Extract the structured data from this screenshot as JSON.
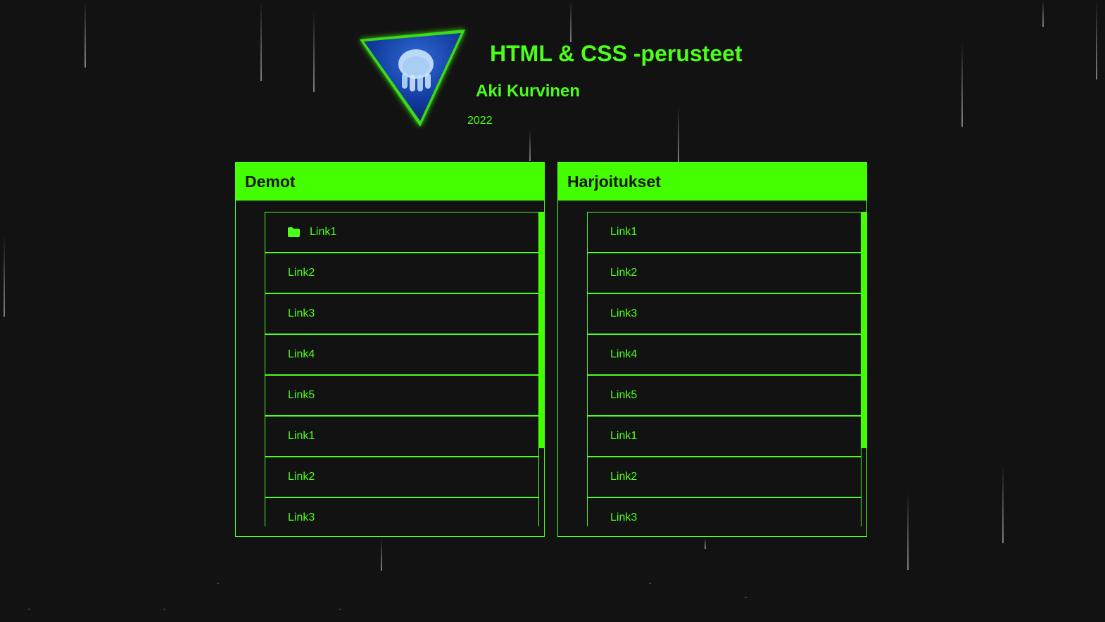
{
  "header": {
    "title": "HTML & CSS -perusteet",
    "author": "Aki Kurvinen",
    "year": "2022",
    "logo_icon": "jellyfish-triangle-logo"
  },
  "colors": {
    "accent": "#44ff00",
    "text_green": "#4cff1a",
    "background": "#121212"
  },
  "panels": [
    {
      "title": "Demot",
      "items": [
        {
          "label": "Link1",
          "icon": "folder-icon"
        },
        {
          "label": "Link2"
        },
        {
          "label": "Link3"
        },
        {
          "label": "Link4"
        },
        {
          "label": "Link5"
        },
        {
          "label": "Link1"
        },
        {
          "label": "Link2"
        },
        {
          "label": "Link3"
        }
      ]
    },
    {
      "title": "Harjoitukset",
      "items": [
        {
          "label": "Link1"
        },
        {
          "label": "Link2"
        },
        {
          "label": "Link3"
        },
        {
          "label": "Link4"
        },
        {
          "label": "Link5"
        },
        {
          "label": "Link1"
        },
        {
          "label": "Link2"
        },
        {
          "label": "Link3"
        }
      ]
    }
  ]
}
